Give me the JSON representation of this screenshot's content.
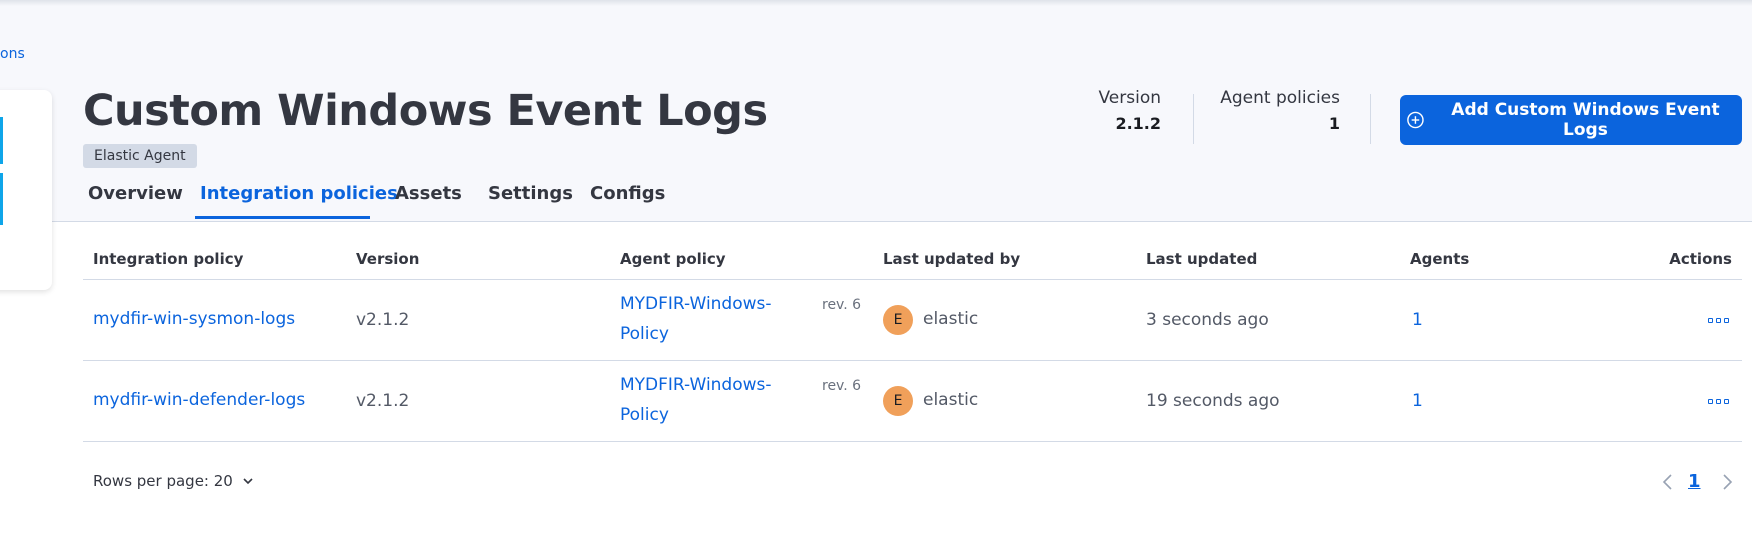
{
  "breadcrumb": {
    "text": "ons"
  },
  "header": {
    "title": "Custom Windows Event Logs",
    "badge": "Elastic Agent",
    "stats": [
      {
        "label": "Version",
        "value": "2.1.2"
      },
      {
        "label": "Agent policies",
        "value": "1"
      }
    ],
    "add_button_label": "Add Custom Windows Event Logs"
  },
  "tabs": [
    {
      "label": "Overview",
      "active": false
    },
    {
      "label": "Integration policies",
      "active": true
    },
    {
      "label": "Assets",
      "active": false
    },
    {
      "label": "Settings",
      "active": false
    },
    {
      "label": "Configs",
      "active": false
    }
  ],
  "table": {
    "columns": [
      "Integration policy",
      "Version",
      "Agent policy",
      "Last updated by",
      "Last updated",
      "Agents",
      "Actions"
    ],
    "rows": [
      {
        "integration_policy": "mydfir-win-sysmon-logs",
        "version": "v2.1.2",
        "agent_policy_line1": "MYDFIR-Windows-",
        "agent_policy_line2": "Policy",
        "revision": "rev. 6",
        "avatar_initial": "E",
        "updated_by": "elastic",
        "last_updated": "3 seconds ago",
        "agents": "1"
      },
      {
        "integration_policy": "mydfir-win-defender-logs",
        "version": "v2.1.2",
        "agent_policy_line1": "MYDFIR-Windows-",
        "agent_policy_line2": "Policy",
        "revision": "rev. 6",
        "avatar_initial": "E",
        "updated_by": "elastic",
        "last_updated": "19 seconds ago",
        "agents": "1"
      }
    ]
  },
  "pagination": {
    "rows_per_page_label": "Rows per page: 20",
    "current_page": "1"
  },
  "colors": {
    "primary": "#0b64dd",
    "header_bg": "#f7f8fc",
    "avatar": "#f0a05a",
    "logo": "#0ea5e9"
  },
  "icons": [
    "windows-logo-icon",
    "plus-circle-icon",
    "chevron-down-icon",
    "chevron-left-icon",
    "chevron-right-icon",
    "boxes-menu-icon"
  ]
}
